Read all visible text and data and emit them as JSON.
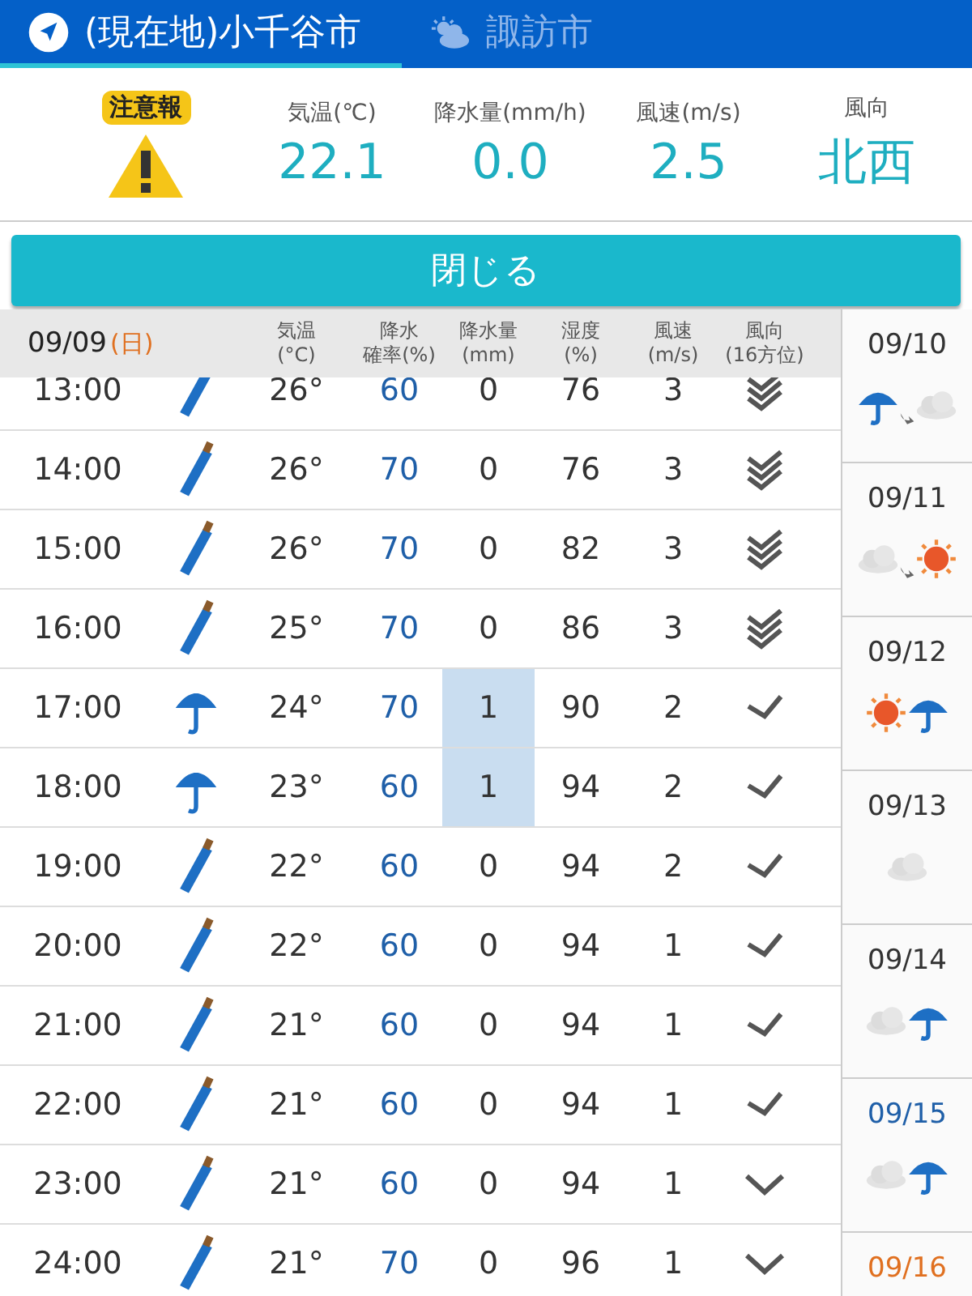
{
  "tabs": [
    {
      "label": "(現在地)小千谷市",
      "selected": true,
      "kind": "location"
    },
    {
      "label": "諏訪市",
      "selected": false,
      "kind": "weather"
    }
  ],
  "current": {
    "alert": "注意報",
    "readings": [
      {
        "label": "気温(℃)",
        "value": "22.1"
      },
      {
        "label": "降水量(mm/h)",
        "value": "0.0"
      },
      {
        "label": "風速(m/s)",
        "value": "2.5"
      },
      {
        "label": "風向",
        "value": "北西"
      }
    ]
  },
  "close_button": "閉じる",
  "hourly": {
    "date": "09/09",
    "weekday": "(日)",
    "columns": [
      {
        "label": "気温",
        "unit": "(°C)"
      },
      {
        "label": "降水",
        "unit": "確率(%)"
      },
      {
        "label": "降水量",
        "unit": "(mm)"
      },
      {
        "label": "湿度",
        "unit": "(%)"
      },
      {
        "label": "風速",
        "unit": "(m/s)"
      },
      {
        "label": "風向",
        "unit": "(16方位)"
      }
    ],
    "rows": [
      {
        "time": "13:00",
        "kind": "closed-umbrella",
        "temp": "26°",
        "pop": "60",
        "precip": "0",
        "highlight": false,
        "humidity": "76",
        "wind": "3",
        "wind_icon": {
          "kind": "double"
        }
      },
      {
        "time": "14:00",
        "kind": "closed-umbrella",
        "temp": "26°",
        "pop": "70",
        "precip": "0",
        "highlight": false,
        "humidity": "76",
        "wind": "3",
        "wind_icon": {
          "kind": "double"
        }
      },
      {
        "time": "15:00",
        "kind": "closed-umbrella",
        "temp": "26°",
        "pop": "70",
        "precip": "0",
        "highlight": false,
        "humidity": "82",
        "wind": "3",
        "wind_icon": {
          "kind": "double"
        }
      },
      {
        "time": "16:00",
        "kind": "closed-umbrella",
        "temp": "25°",
        "pop": "70",
        "precip": "0",
        "highlight": false,
        "humidity": "86",
        "wind": "3",
        "wind_icon": {
          "kind": "double"
        }
      },
      {
        "time": "17:00",
        "kind": "umbrella",
        "temp": "24°",
        "pop": "70",
        "precip": "1",
        "highlight": true,
        "humidity": "90",
        "wind": "2",
        "wind_icon": {
          "kind": "single"
        }
      },
      {
        "time": "18:00",
        "kind": "umbrella",
        "temp": "23°",
        "pop": "60",
        "precip": "1",
        "highlight": true,
        "humidity": "94",
        "wind": "2",
        "wind_icon": {
          "kind": "single"
        }
      },
      {
        "time": "19:00",
        "kind": "closed-umbrella",
        "temp": "22°",
        "pop": "60",
        "precip": "0",
        "highlight": false,
        "humidity": "94",
        "wind": "2",
        "wind_icon": {
          "kind": "single"
        }
      },
      {
        "time": "20:00",
        "kind": "closed-umbrella",
        "temp": "22°",
        "pop": "60",
        "precip": "0",
        "highlight": false,
        "humidity": "94",
        "wind": "1",
        "wind_icon": {
          "kind": "single"
        }
      },
      {
        "time": "21:00",
        "kind": "closed-umbrella",
        "temp": "21°",
        "pop": "60",
        "precip": "0",
        "highlight": false,
        "humidity": "94",
        "wind": "1",
        "wind_icon": {
          "kind": "single"
        }
      },
      {
        "time": "22:00",
        "kind": "closed-umbrella",
        "temp": "21°",
        "pop": "60",
        "precip": "0",
        "highlight": false,
        "humidity": "94",
        "wind": "1",
        "wind_icon": {
          "kind": "single"
        }
      },
      {
        "time": "23:00",
        "kind": "closed-umbrella",
        "temp": "21°",
        "pop": "60",
        "precip": "0",
        "highlight": false,
        "humidity": "94",
        "wind": "1",
        "wind_icon": {
          "kind": "down"
        }
      },
      {
        "time": "24:00",
        "kind": "closed-umbrella",
        "temp": "21°",
        "pop": "70",
        "precip": "0",
        "highlight": false,
        "humidity": "96",
        "wind": "1",
        "wind_icon": {
          "kind": "down"
        }
      }
    ]
  },
  "days": [
    {
      "date": "09/10",
      "color": "#333333",
      "change": true,
      "weather": [
        {
          "kind": "rain"
        },
        {
          "kind": "cloud"
        }
      ]
    },
    {
      "date": "09/11",
      "color": "#333333",
      "change": true,
      "weather": [
        {
          "kind": "cloud"
        },
        {
          "kind": "sun"
        }
      ]
    },
    {
      "date": "09/12",
      "color": "#333333",
      "change": false,
      "weather": [
        {
          "kind": "sun"
        },
        {
          "kind": "rain"
        }
      ]
    },
    {
      "date": "09/13",
      "color": "#333333",
      "weather": [
        {
          "kind": "cloud"
        }
      ]
    },
    {
      "date": "09/14",
      "color": "#333333",
      "change": false,
      "weather": [
        {
          "kind": "cloud"
        },
        {
          "kind": "rain"
        }
      ]
    },
    {
      "date": "09/15",
      "color": "#1f5fa8",
      "change": false,
      "weather": [
        {
          "kind": "cloud"
        },
        {
          "kind": "rain"
        }
      ]
    },
    {
      "date": "09/16",
      "color": "#e07020"
    }
  ]
}
